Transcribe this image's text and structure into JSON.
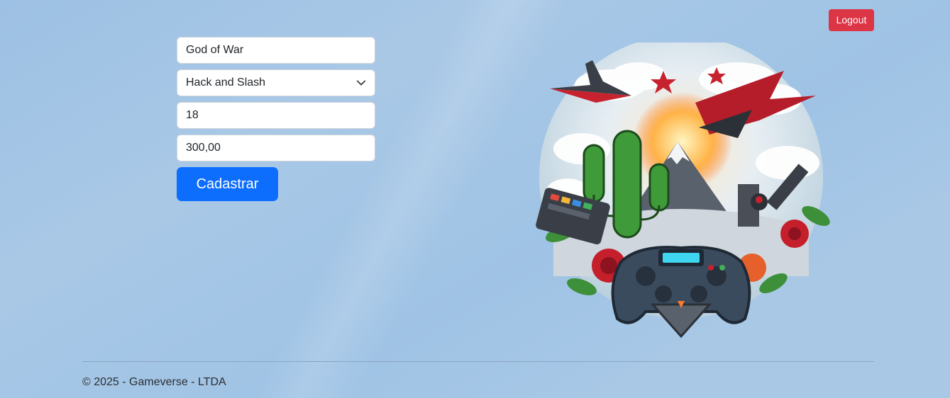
{
  "header": {
    "logout_label": "Logout"
  },
  "form": {
    "name_value": "God of War",
    "genre_value": "Hack and Slash",
    "age_value": "18",
    "price_value": "300,00",
    "submit_label": "Cadastrar"
  },
  "footer": {
    "copyright": "© 2025 - Gameverse - LTDA"
  },
  "colors": {
    "logout": "#dc3545",
    "primary": "#0d6efd",
    "background": "#a9c8e6"
  },
  "icons": {
    "select_arrow": "chevron-down-icon",
    "hero": "gaming-collage-illustration"
  }
}
